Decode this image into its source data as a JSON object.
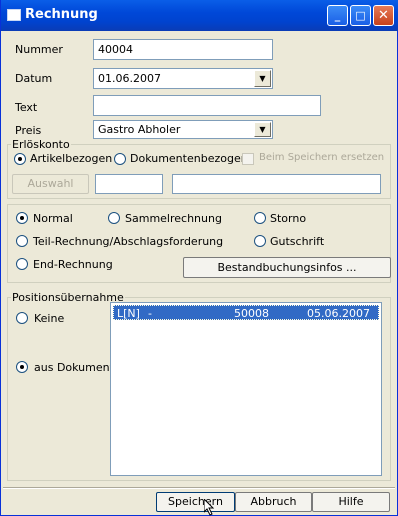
{
  "window": {
    "title": "Rechnung",
    "minimize": "_",
    "maximize": "□",
    "close": "✕"
  },
  "fields": {
    "nummer_label": "Nummer",
    "nummer_value": "40004",
    "datum_label": "Datum",
    "datum_value": "01.06.2007",
    "text_label": "Text",
    "text_value": "",
    "preis_label": "Preis",
    "preis_value": "Gastro Abholer"
  },
  "erloeskonto": {
    "title": "Erlöskonto",
    "option_artikel": "Artikelbezogen",
    "option_dokument": "Dokumentenbezogen",
    "beim_speichern": "Beim Speichern ersetzen",
    "auswahl_button": "Auswahl",
    "field1_value": "",
    "field2_value": ""
  },
  "rechnungsart": {
    "normal": "Normal",
    "sammelrechnung": "Sammelrechnung",
    "storno": "Storno",
    "teil": "Teil-Rechnung/Abschlagsforderung",
    "gutschrift": "Gutschrift",
    "end": "End-Rechnung",
    "bestand_button": "Bestandbuchungsinfos ..."
  },
  "positionsuebernahme": {
    "title": "Positionsübernahme",
    "keine": "Keine",
    "aus_dokument": "aus Dokument",
    "rows": [
      {
        "type": "L[N]",
        "sep": "-",
        "number": "50008",
        "date": "05.06.2007"
      }
    ]
  },
  "footer": {
    "speichern": "Speichern",
    "abbruch": "Abbruch",
    "hilfe": "Hilfe"
  }
}
